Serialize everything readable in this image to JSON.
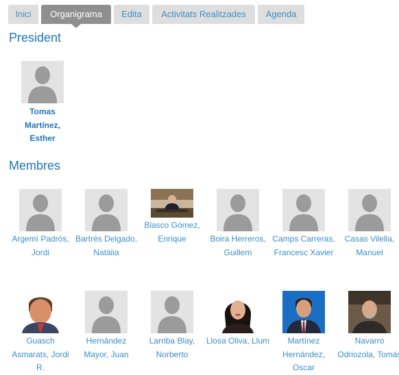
{
  "tabs": [
    {
      "label": "Inici",
      "active": false
    },
    {
      "label": "Organigrama",
      "active": true
    },
    {
      "label": "Edita",
      "active": false
    },
    {
      "label": "Activitats Realitzades",
      "active": false
    },
    {
      "label": "Agenda",
      "active": false
    }
  ],
  "president": {
    "title": "President",
    "members": [
      {
        "name": "Tomas Martínez, Esther",
        "photo": "placeholder"
      }
    ]
  },
  "membres": {
    "title": "Membres",
    "members": [
      {
        "name": "Argemí Padrós, Jordi",
        "photo": "placeholder"
      },
      {
        "name": "Bartrés Delgado, Natàlia",
        "photo": "placeholder"
      },
      {
        "name": "Blasco Gómez, Enrique",
        "photo": "photo-desk"
      },
      {
        "name": "Boira Herreros, Guillem",
        "photo": "placeholder"
      },
      {
        "name": "Camps Carreras, Francesc Xavier",
        "photo": "placeholder"
      },
      {
        "name": "Casas Vilella, Manuel",
        "photo": "placeholder"
      },
      {
        "name": "Guasch Asmarats, Jordi R.",
        "photo": "photo-man-red"
      },
      {
        "name": "Hernández Mayor, Juan",
        "photo": "placeholder"
      },
      {
        "name": "Larriba Blay, Norberto",
        "photo": "placeholder"
      },
      {
        "name": "Llosa Oliva, Llum",
        "photo": "photo-woman"
      },
      {
        "name": "Martínez Hernández, Oscar",
        "photo": "photo-man-blue"
      },
      {
        "name": "Navarro Odriozola, Tomás",
        "photo": "photo-man-beard"
      }
    ]
  }
}
